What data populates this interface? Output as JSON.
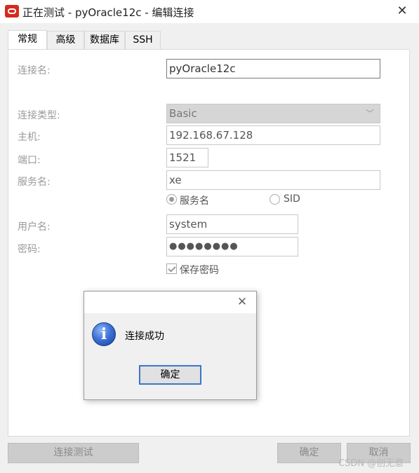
{
  "window": {
    "title": "正在测试 - pyOracle12c - 编辑连接",
    "close": "✕"
  },
  "tabs": [
    {
      "label": "常规"
    },
    {
      "label": "高级"
    },
    {
      "label": "数据库"
    },
    {
      "label": "SSH"
    }
  ],
  "form": {
    "conn_name_label": "连接名:",
    "conn_name_value": "pyOracle12c",
    "conn_type_label": "连接类型:",
    "conn_type_value": "Basic",
    "host_label": "主机:",
    "host_value": "192.168.67.128",
    "port_label": "端口:",
    "port_value": "1521",
    "service_label": "服务名:",
    "service_value": "xe",
    "radio_service": "服务名",
    "radio_sid": "SID",
    "user_label": "用户名:",
    "user_value": "system",
    "password_label": "密码:",
    "password_value": "●●●●●●●●",
    "save_password": "保存密码"
  },
  "buttons": {
    "test": "连接测试",
    "ok": "确定",
    "cancel": "取消"
  },
  "dialog": {
    "close": "✕",
    "icon": "i",
    "message": "连接成功",
    "ok": "确定"
  },
  "watermark": "CSDN @创无意",
  "icons": {
    "app": "oracle-icon",
    "info": "info-icon"
  }
}
